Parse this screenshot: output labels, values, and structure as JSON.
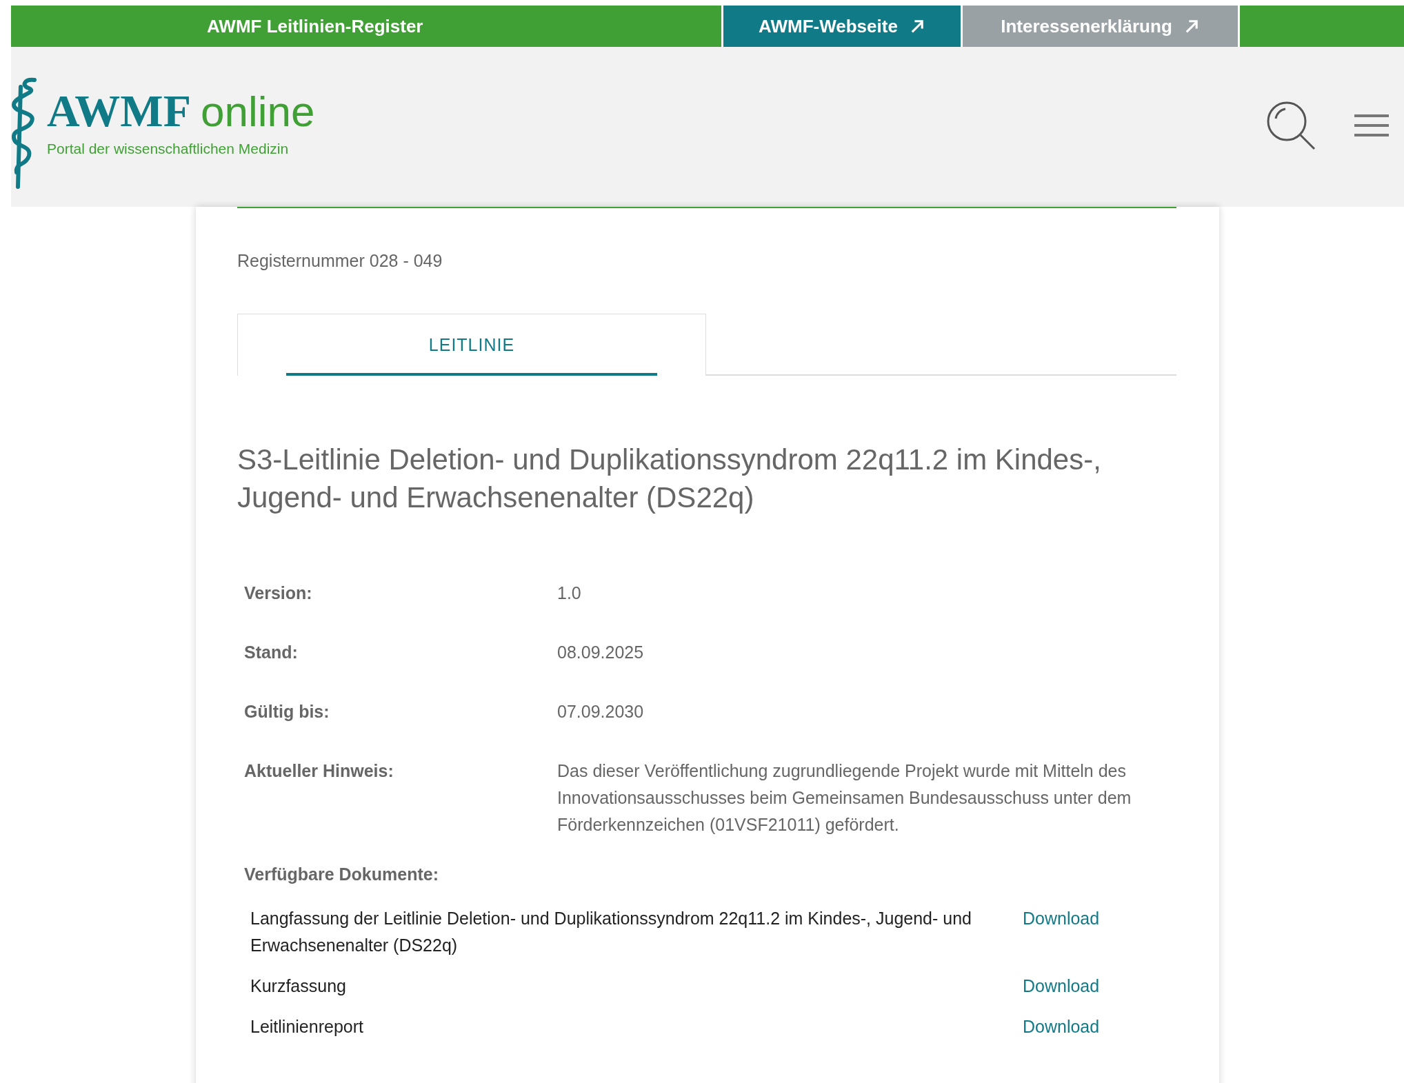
{
  "top_bar": {
    "title": "AWMF Leitlinien-Register",
    "links": [
      {
        "label": "AWMF-Webseite",
        "kind": "primary"
      },
      {
        "label": "Interessenerklärung",
        "kind": "secondary"
      }
    ]
  },
  "logo": {
    "name": "AWMF",
    "suffix": "online",
    "tagline": "Portal der wissenschaftlichen Medizin"
  },
  "register_number": "Registernummer 028 - 049",
  "tabs": [
    {
      "label": "LEITLINIE",
      "selected": true
    }
  ],
  "title": "S3-Leitlinie Deletion- und Duplikationssyndrom 22q11.2 im Kindes-, Jugend- und Erwachsenenalter (DS22q)",
  "details": [
    {
      "label": "Version:",
      "value": "1.0"
    },
    {
      "label": "Stand:",
      "value": "08.09.2025"
    },
    {
      "label": "Gültig bis:",
      "value": "07.09.2030"
    },
    {
      "label": "Aktueller Hinweis:",
      "value": "Das dieser Veröffentlichung zugrundliegende Projekt wurde mit Mitteln des Innovationsausschusses beim Gemeinsamen Bundesausschuss unter dem Förderkennzeichen (01VSF21011) gefördert."
    }
  ],
  "documents": {
    "heading": "Verfügbare Dokumente:",
    "items": [
      {
        "name": "Langfassung der Leitlinie Deletion- und Duplikationssyndrom 22q11.2 im Kindes-, Jugend- und Erwachsenenalter (DS22q)",
        "link": "Download"
      },
      {
        "name": "Kurzfassung",
        "link": "Download"
      },
      {
        "name": "Leitlinienreport",
        "link": "Download"
      }
    ]
  }
}
